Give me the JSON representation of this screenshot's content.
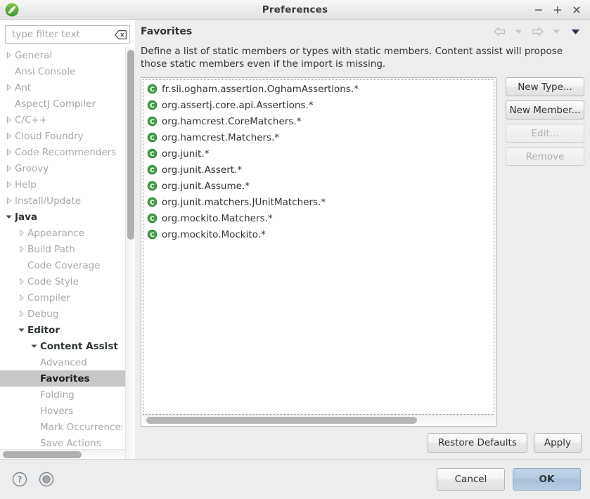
{
  "window": {
    "title": "Preferences",
    "logo_icon": "eclipse-logo-icon",
    "controls": [
      {
        "name": "minimize-button",
        "icon": "minimize-icon",
        "glyph": "−"
      },
      {
        "name": "maximize-button",
        "icon": "maximize-icon",
        "glyph": "+"
      },
      {
        "name": "close-button",
        "icon": "close-icon",
        "glyph": "×"
      }
    ]
  },
  "sidebar": {
    "filter": {
      "placeholder": "type filter text",
      "value": "",
      "clear_icon": "clear-filter-icon"
    },
    "items": [
      {
        "label": "General",
        "level": 0,
        "expandable": true,
        "expanded": false,
        "selected": false,
        "bold": false
      },
      {
        "label": "Ansi Console",
        "level": 0,
        "expandable": false,
        "expanded": false,
        "selected": false,
        "bold": false
      },
      {
        "label": "Ant",
        "level": 0,
        "expandable": true,
        "expanded": false,
        "selected": false,
        "bold": false
      },
      {
        "label": "AspectJ Compiler",
        "level": 0,
        "expandable": false,
        "expanded": false,
        "selected": false,
        "bold": false
      },
      {
        "label": "C/C++",
        "level": 0,
        "expandable": true,
        "expanded": false,
        "selected": false,
        "bold": false
      },
      {
        "label": "Cloud Foundry",
        "level": 0,
        "expandable": true,
        "expanded": false,
        "selected": false,
        "bold": false
      },
      {
        "label": "Code Recommenders",
        "level": 0,
        "expandable": true,
        "expanded": false,
        "selected": false,
        "bold": false
      },
      {
        "label": "Groovy",
        "level": 0,
        "expandable": true,
        "expanded": false,
        "selected": false,
        "bold": false
      },
      {
        "label": "Help",
        "level": 0,
        "expandable": true,
        "expanded": false,
        "selected": false,
        "bold": false
      },
      {
        "label": "Install/Update",
        "level": 0,
        "expandable": true,
        "expanded": false,
        "selected": false,
        "bold": false
      },
      {
        "label": "Java",
        "level": 0,
        "expandable": true,
        "expanded": true,
        "selected": false,
        "bold": true
      },
      {
        "label": "Appearance",
        "level": 1,
        "expandable": true,
        "expanded": false,
        "selected": false,
        "bold": false
      },
      {
        "label": "Build Path",
        "level": 1,
        "expandable": true,
        "expanded": false,
        "selected": false,
        "bold": false
      },
      {
        "label": "Code Coverage",
        "level": 1,
        "expandable": false,
        "expanded": false,
        "selected": false,
        "bold": false
      },
      {
        "label": "Code Style",
        "level": 1,
        "expandable": true,
        "expanded": false,
        "selected": false,
        "bold": false
      },
      {
        "label": "Compiler",
        "level": 1,
        "expandable": true,
        "expanded": false,
        "selected": false,
        "bold": false
      },
      {
        "label": "Debug",
        "level": 1,
        "expandable": true,
        "expanded": false,
        "selected": false,
        "bold": false
      },
      {
        "label": "Editor",
        "level": 1,
        "expandable": true,
        "expanded": true,
        "selected": false,
        "bold": true
      },
      {
        "label": "Content Assist",
        "level": 2,
        "expandable": true,
        "expanded": true,
        "selected": false,
        "bold": true
      },
      {
        "label": "Advanced",
        "level": 2,
        "expandable": false,
        "expanded": false,
        "selected": false,
        "bold": false
      },
      {
        "label": "Favorites",
        "level": 2,
        "expandable": false,
        "expanded": false,
        "selected": true,
        "bold": true
      },
      {
        "label": "Folding",
        "level": 2,
        "expandable": false,
        "expanded": false,
        "selected": false,
        "bold": false
      },
      {
        "label": "Hovers",
        "level": 2,
        "expandable": false,
        "expanded": false,
        "selected": false,
        "bold": false
      },
      {
        "label": "Mark Occurrences",
        "level": 2,
        "expandable": false,
        "expanded": false,
        "selected": false,
        "bold": false
      },
      {
        "label": "Save Actions",
        "level": 2,
        "expandable": false,
        "expanded": false,
        "selected": false,
        "bold": false
      }
    ]
  },
  "content": {
    "title": "Favorites",
    "description": "Define a list of static members or types with static members. Content assist will propose those static members even if the import is missing.",
    "nav": [
      {
        "name": "back-button",
        "icon": "arrow-left-icon"
      },
      {
        "name": "back-history-dropdown",
        "icon": "chevron-down-icon"
      },
      {
        "name": "forward-button",
        "icon": "arrow-right-icon"
      },
      {
        "name": "forward-history-dropdown",
        "icon": "chevron-down-icon"
      },
      {
        "name": "view-menu-button",
        "icon": "triangle-down-icon"
      }
    ],
    "list": {
      "item_icon": "java-class-icon",
      "items": [
        "fr.sii.ogham.assertion.OghamAssertions.*",
        "org.assertj.core.api.Assertions.*",
        "org.hamcrest.CoreMatchers.*",
        "org.hamcrest.Matchers.*",
        "org.junit.*",
        "org.junit.Assert.*",
        "org.junit.Assume.*",
        "org.junit.matchers.JUnitMatchers.*",
        "org.mockito.Matchers.*",
        "org.mockito.Mockito.*"
      ]
    },
    "side_buttons": [
      {
        "label": "New Type...",
        "name": "new-type-button",
        "enabled": true
      },
      {
        "label": "New Member...",
        "name": "new-member-button",
        "enabled": true
      },
      {
        "label": "Edit...",
        "name": "edit-button",
        "enabled": false
      },
      {
        "label": "Remove",
        "name": "remove-button",
        "enabled": false
      }
    ],
    "apply_row": [
      {
        "label": "Restore Defaults",
        "name": "restore-defaults-button",
        "enabled": true
      },
      {
        "label": "Apply",
        "name": "apply-button",
        "enabled": true
      }
    ]
  },
  "footer": {
    "icons": [
      {
        "name": "help-icon",
        "glyph": "?"
      },
      {
        "name": "shell-icon",
        "glyph": ""
      }
    ],
    "buttons": [
      {
        "label": "Cancel",
        "name": "cancel-button",
        "primary": false
      },
      {
        "label": "OK",
        "name": "ok-button",
        "primary": true
      }
    ]
  },
  "colors": {
    "accent": "#b2c8df",
    "selection": "#c7c7c7",
    "window_bg": "#ededed",
    "icon_green": "#3f9c35"
  }
}
